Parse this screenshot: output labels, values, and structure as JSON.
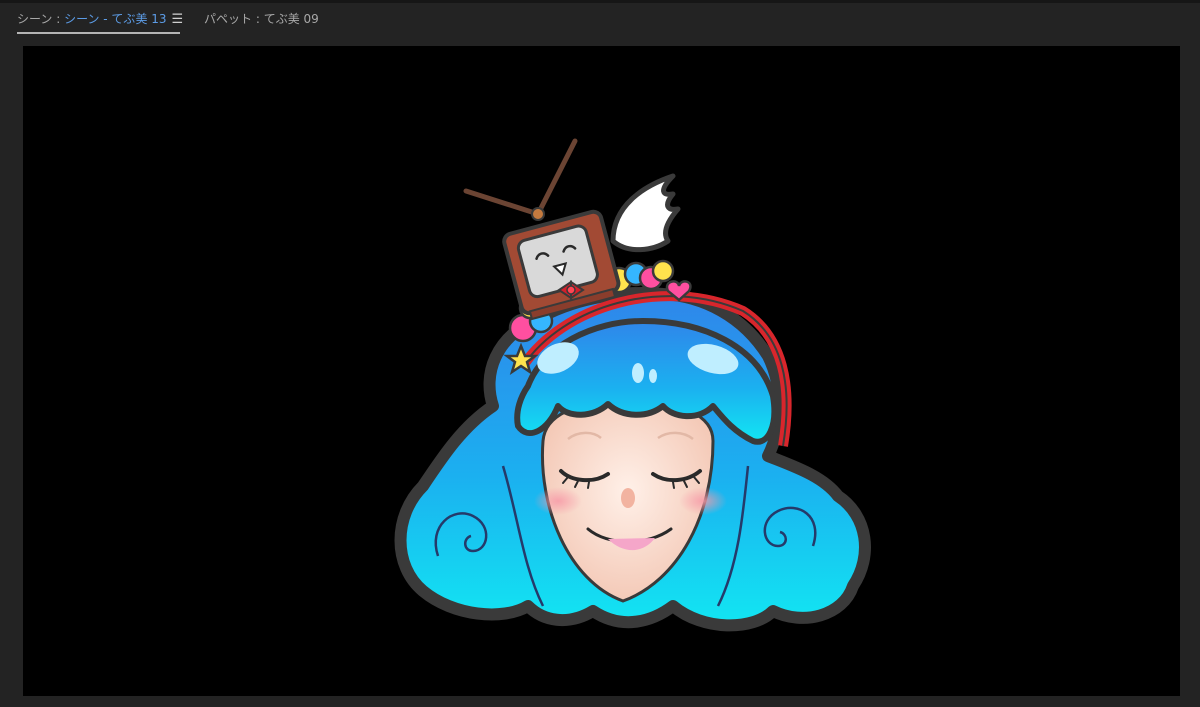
{
  "tabs": [
    {
      "label": "シーン : ",
      "name": "シーン - てぶ美 13",
      "menu_icon": "hamburger-menu-icon",
      "active": true
    },
    {
      "label": "パペット : ",
      "name": "てぶ美 09",
      "active": false
    }
  ],
  "colors": {
    "panel_bg": "#232323",
    "stage_bg": "#000000",
    "active_tab_text": "#5c9ce6",
    "hair_top": "#2f86ea",
    "hair_bottom": "#12e6f2",
    "skin": "#fde3d6"
  },
  "stage": {
    "content": "character-puppet",
    "elements": [
      "tv-head-icon",
      "wing-icon",
      "heart-hair-accessories",
      "headband",
      "closed-eyes",
      "smile-mouth"
    ]
  }
}
